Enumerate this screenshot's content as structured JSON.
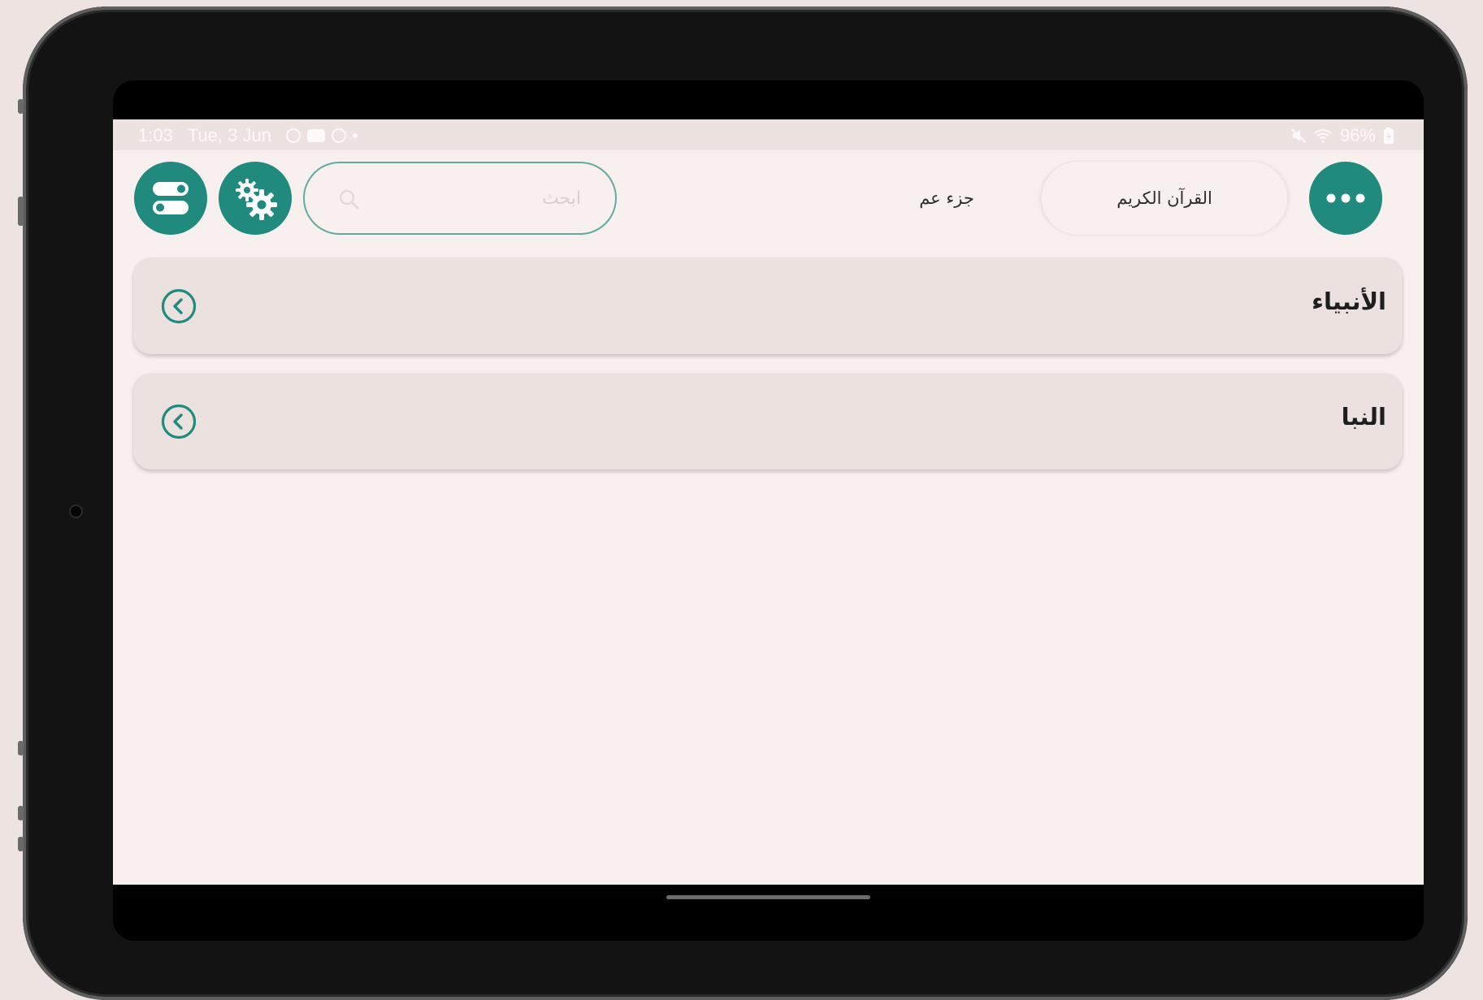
{
  "status_bar": {
    "time": "1:03",
    "date": "Tue, 3 Jun",
    "battery": "96%",
    "icons": [
      "settings-status-icon",
      "youtube-status-icon",
      "circle-status-icon",
      "dot-status-icon",
      "mute-icon",
      "wifi-icon",
      "battery-charging-icon"
    ]
  },
  "header": {
    "menu_icon": "more-horizontal-icon",
    "tabs": [
      {
        "label": "القرآن الكريم",
        "active": true
      },
      {
        "label": "جزء عم",
        "active": false
      }
    ],
    "search": {
      "placeholder": "ابحث",
      "value": "",
      "icon": "search-icon"
    },
    "settings_icon": "gears-icon",
    "toggles_icon": "toggles-icon"
  },
  "list": {
    "items": [
      {
        "label": "الأنبياء",
        "icon": "chevron-left-circle-icon"
      },
      {
        "label": "النبا",
        "icon": "chevron-left-circle-icon"
      }
    ]
  },
  "colors": {
    "accent": "#1f8a7d",
    "background": "#f8f0ee",
    "card": "#ebe1df",
    "status_bar": "#ece2e0"
  }
}
